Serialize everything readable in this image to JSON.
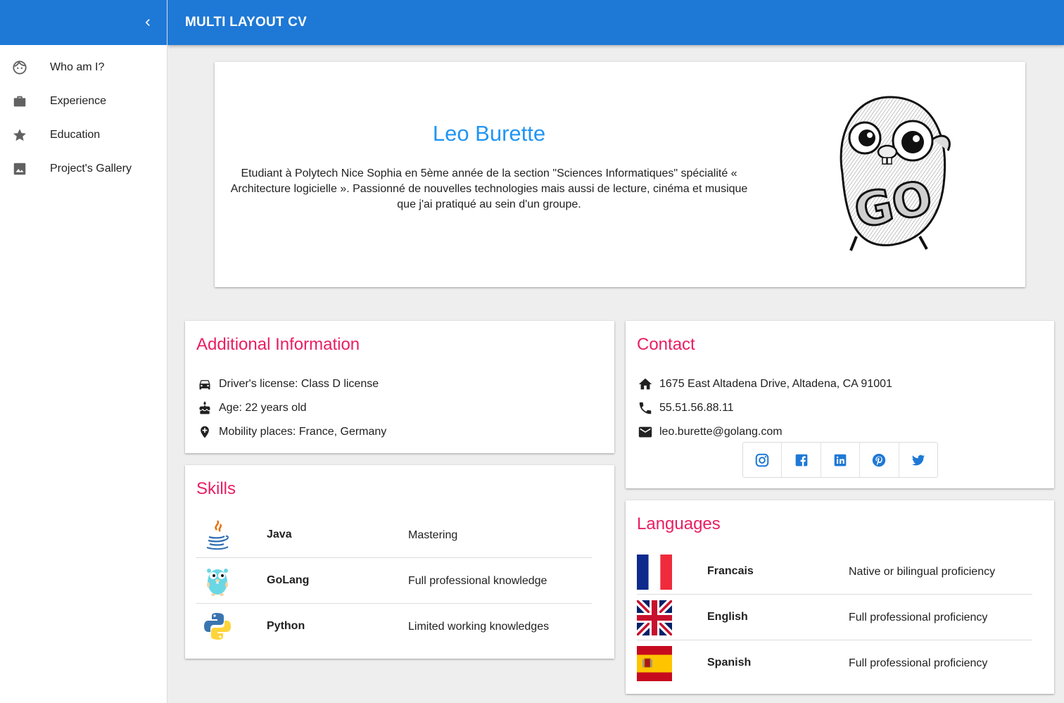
{
  "app": {
    "title": "MULTI LAYOUT CV",
    "accent_color": "#1e78d6",
    "section_title_color": "#e91e63",
    "name_color": "#2196f3"
  },
  "sidebar": {
    "collapse_icon": "chevron-left-icon",
    "items": [
      {
        "label": "Who am I?",
        "icon": "face-icon"
      },
      {
        "label": "Experience",
        "icon": "briefcase-icon"
      },
      {
        "label": "Education",
        "icon": "star-icon"
      },
      {
        "label": "Project's Gallery",
        "icon": "image-icon"
      }
    ]
  },
  "profile": {
    "name": "Leo Burette",
    "bio": "Etudiant à Polytech Nice Sophia en 5ème année de la section \"Sciences Informatiques\" spécialité « Architecture logicielle ». Passionné de nouvelles technologies mais aussi de lecture, cinéma et musique que j'ai pratiqué au sein d'un groupe.",
    "avatar": "gopher-go-illustration"
  },
  "additional_info": {
    "title": "Additional Information",
    "items": [
      {
        "icon": "car-icon",
        "text": "Driver's license: Class D license"
      },
      {
        "icon": "cake-icon",
        "text": "Age: 22 years old"
      },
      {
        "icon": "add-location-icon",
        "text": "Mobility places: France, Germany"
      }
    ]
  },
  "contact": {
    "title": "Contact",
    "items": [
      {
        "icon": "home-icon",
        "text": "1675 East Altadena Drive, Altadena, CA 91001"
      },
      {
        "icon": "phone-icon",
        "text": "55.51.56.88.11"
      },
      {
        "icon": "mail-icon",
        "text": "leo.burette@golang.com"
      }
    ],
    "social": [
      "instagram-icon",
      "facebook-icon",
      "linkedin-icon",
      "pinterest-icon",
      "twitter-icon"
    ]
  },
  "skills": {
    "title": "Skills",
    "rows": [
      {
        "icon": "java-logo",
        "name": "Java",
        "level": "Mastering"
      },
      {
        "icon": "golang-gopher-logo",
        "name": "GoLang",
        "level": "Full professional knowledge"
      },
      {
        "icon": "python-logo",
        "name": "Python",
        "level": "Limited working knowledges"
      }
    ]
  },
  "languages": {
    "title": "Languages",
    "rows": [
      {
        "icon": "france-flag",
        "name": "Francais",
        "level": "Native or bilingual proficiency"
      },
      {
        "icon": "uk-flag",
        "name": "English",
        "level": "Full professional proficiency"
      },
      {
        "icon": "spain-flag",
        "name": "Spanish",
        "level": "Full professional proficiency"
      }
    ]
  }
}
